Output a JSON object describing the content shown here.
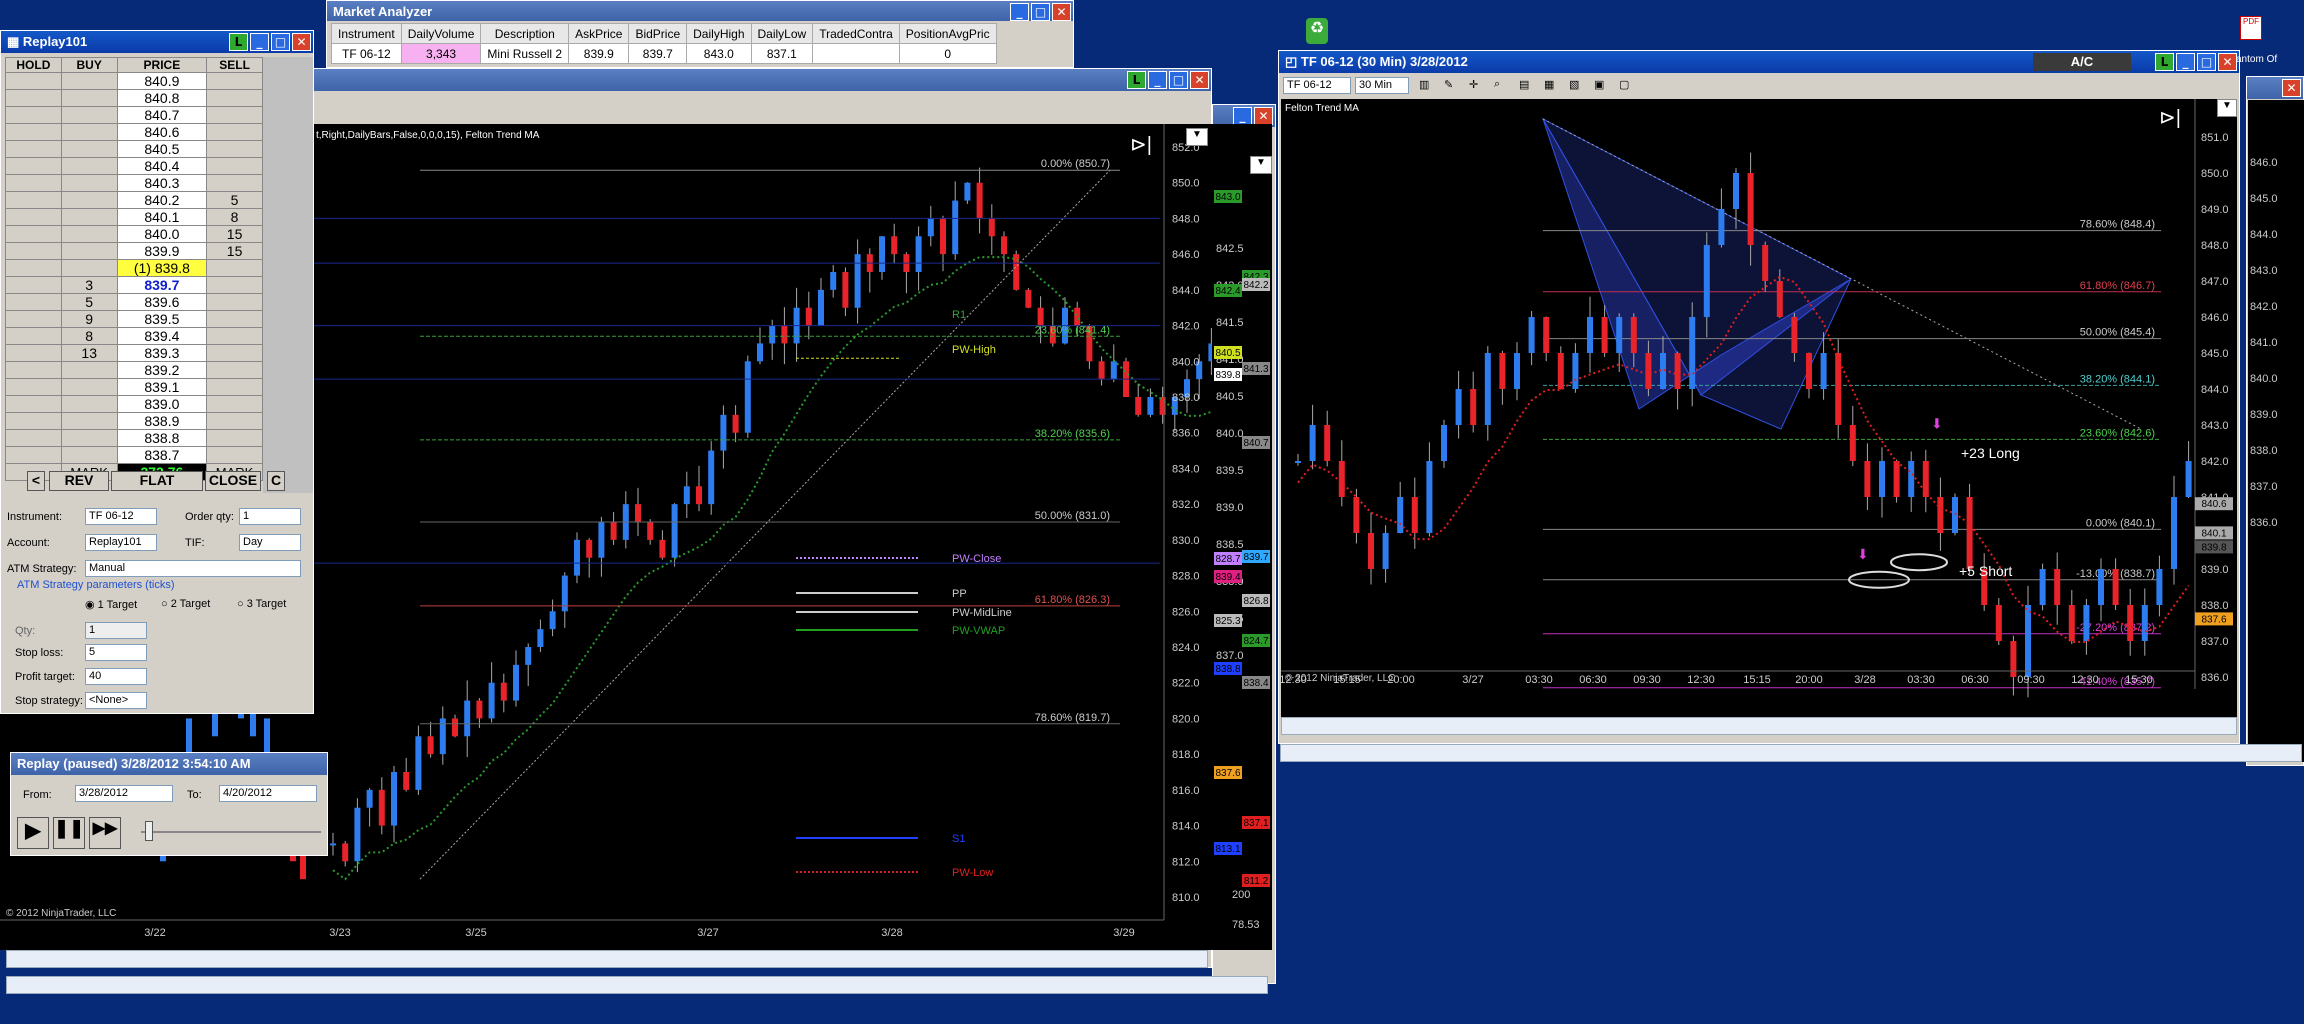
{
  "market_analyzer": {
    "title": "Market Analyzer",
    "headers": [
      "Instrument",
      "DailyVolume",
      "Description",
      "AskPrice",
      "BidPrice",
      "DailyHigh",
      "DailyLow",
      "TradedContra",
      "PositionAvgPric"
    ],
    "row": [
      "TF 06-12",
      "3,343",
      "Mini Russell 2",
      "839.9",
      "839.7",
      "843.0",
      "837.1",
      "",
      "0"
    ]
  },
  "replay101": {
    "title": "Replay101",
    "headers": [
      "HOLD",
      "BUY",
      "PRICE",
      "SELL"
    ],
    "rows": [
      [
        "",
        "",
        "840.9",
        ""
      ],
      [
        "",
        "",
        "840.8",
        ""
      ],
      [
        "",
        "",
        "840.7",
        ""
      ],
      [
        "",
        "",
        "840.6",
        ""
      ],
      [
        "",
        "",
        "840.5",
        ""
      ],
      [
        "",
        "",
        "840.4",
        ""
      ],
      [
        "",
        "",
        "840.3",
        ""
      ],
      [
        "",
        "",
        "840.2",
        "5"
      ],
      [
        "",
        "",
        "840.1",
        "8"
      ],
      [
        "",
        "",
        "840.0",
        "15"
      ],
      [
        "",
        "",
        "839.9",
        "15"
      ],
      [
        "",
        "",
        "(1) 839.8",
        ""
      ],
      [
        "",
        "3",
        "839.7",
        ""
      ],
      [
        "",
        "5",
        "839.6",
        ""
      ],
      [
        "",
        "9",
        "839.5",
        ""
      ],
      [
        "",
        "8",
        "839.4",
        ""
      ],
      [
        "",
        "13",
        "839.3",
        ""
      ],
      [
        "",
        "",
        "839.2",
        ""
      ],
      [
        "",
        "",
        "839.1",
        ""
      ],
      [
        "",
        "",
        "839.0",
        ""
      ],
      [
        "",
        "",
        "838.9",
        ""
      ],
      [
        "",
        "",
        "838.8",
        ""
      ],
      [
        "",
        "",
        "838.7",
        ""
      ]
    ],
    "mark_left": "MARK",
    "pnl": "272.76",
    "mark_right": "MARK",
    "btn_lt": "<",
    "btn_rev": "REV",
    "btn_flat": "FLAT",
    "btn_close": "CLOSE",
    "btn_c": "C",
    "instrument_label": "Instrument:",
    "instrument": "TF 06-12",
    "orderqty_label": "Order qty:",
    "orderqty": "1",
    "account_label": "Account:",
    "account": "Replay101",
    "tif_label": "TIF:",
    "tif": "Day",
    "atm_label": "ATM Strategy:",
    "atm": "Manual",
    "atm_params": "ATM Strategy parameters (ticks)",
    "t1": "1 Target",
    "t2": "2 Target",
    "t3": "3 Target",
    "qty_label": "Qty:",
    "qty": "1",
    "stop_label": "Stop loss:",
    "stop": "5",
    "profit_label": "Profit target:",
    "profit": "40",
    "stopstrat_label": "Stop strategy:",
    "stopstrat": "<None>"
  },
  "replay_ctrl": {
    "title": "Replay (paused) 3/28/2012 3:54:10 AM",
    "from_label": "From:",
    "from": "3/28/2012",
    "to_label": "To:",
    "to": "4/20/2012"
  },
  "left_chart": {
    "indicator_line": "t,Right,DailyBars,False,0,0,0,15), Felton Trend MA",
    "copyright": "© 2012 NinjaTrader, LLC",
    "x_labels": [
      "3/22",
      "3/23",
      "3/25",
      "3/27",
      "3/28",
      "3/29"
    ],
    "y_labels": [
      "852.0",
      "850.0",
      "848.0",
      "846.0",
      "844.0",
      "842.0",
      "840.0",
      "838.0",
      "836.0",
      "834.0",
      "832.0",
      "830.0",
      "828.0",
      "826.0",
      "824.0",
      "822.0",
      "820.0",
      "818.0",
      "816.0",
      "814.0",
      "812.0",
      "810.0"
    ],
    "y2_labels": [
      "842.5",
      "842.0",
      "841.5",
      "841.0",
      "840.5",
      "840.0",
      "839.5",
      "839.0",
      "838.5",
      "838.0",
      "837.5",
      "837.0"
    ],
    "fib": [
      "0.00% (850.7)",
      "23.60% (841.4)",
      "38.20% (835.6)",
      "50.00% (831.0)",
      "61.80% (826.3)",
      "78.60% (819.7)"
    ],
    "pivots": [
      "R1",
      "PW-High",
      "PW-Close",
      "PP",
      "PW-MidLine",
      "PW-VWAP",
      "S1",
      "PW-Low"
    ],
    "price_boxes": [
      "843.0",
      "842.3",
      "842.4",
      "842.2",
      "840.5",
      "841.3",
      "839.8",
      "840.7",
      "828.7",
      "839.7",
      "839.4",
      "826.8",
      "825.3",
      "824.7",
      "838.8",
      "838.4",
      "837.6",
      "837.1",
      "813.1",
      "811.2"
    ],
    "bottom_right": [
      "200",
      "78.53"
    ]
  },
  "right_chart": {
    "title": "TF 06-12 (30 Min)  3/28/2012",
    "instrument": "TF 06-12",
    "period": "30 Min",
    "indicator": "Felton Trend MA",
    "copyright": "© 2012 NinjaTrader, LLC",
    "ac": "A/C",
    "desktop": "antom Of",
    "desktop2": "",
    "x_labels": [
      "12:30",
      "15:15",
      "20:00",
      "3/27",
      "03:30",
      "06:30",
      "09:30",
      "12:30",
      "15:15",
      "20:00",
      "3/28",
      "03:30",
      "06:30",
      "09:30",
      "12:30",
      "15:30"
    ],
    "y_labels": [
      "851.0",
      "850.0",
      "849.0",
      "848.0",
      "847.0",
      "846.0",
      "845.0",
      "844.0",
      "843.0",
      "842.0",
      "841.0",
      "840.0",
      "839.0",
      "838.0",
      "837.0",
      "836.0"
    ],
    "y2_labels": [
      "846.0",
      "845.0",
      "844.0",
      "843.0",
      "842.0",
      "841.0",
      "840.0",
      "839.0",
      "838.0",
      "837.0",
      "836.0"
    ],
    "fib": [
      "78.60% (848.4)",
      "61.80% (846.7)",
      "50.00% (845.4)",
      "38.20% (844.1)",
      "23.60% (842.6)",
      "0.00% (840.1)",
      "-13.00% (838.7)",
      "-27.20% (837.2)",
      "-41.40% (835.7)"
    ],
    "ann_long": "+23 Long",
    "ann_short": "+5 Short",
    "price_boxes": [
      "840.6",
      "840.1",
      "839.8",
      "837.6"
    ]
  },
  "colors": {
    "desktop": "#062a78",
    "title_active": "#0a3aa8",
    "up": "#2e7df0",
    "down": "#e8242a",
    "ema_green": "#2a9a2a",
    "ema_yellow": "#f0e040",
    "ema_red": "#e02020"
  }
}
